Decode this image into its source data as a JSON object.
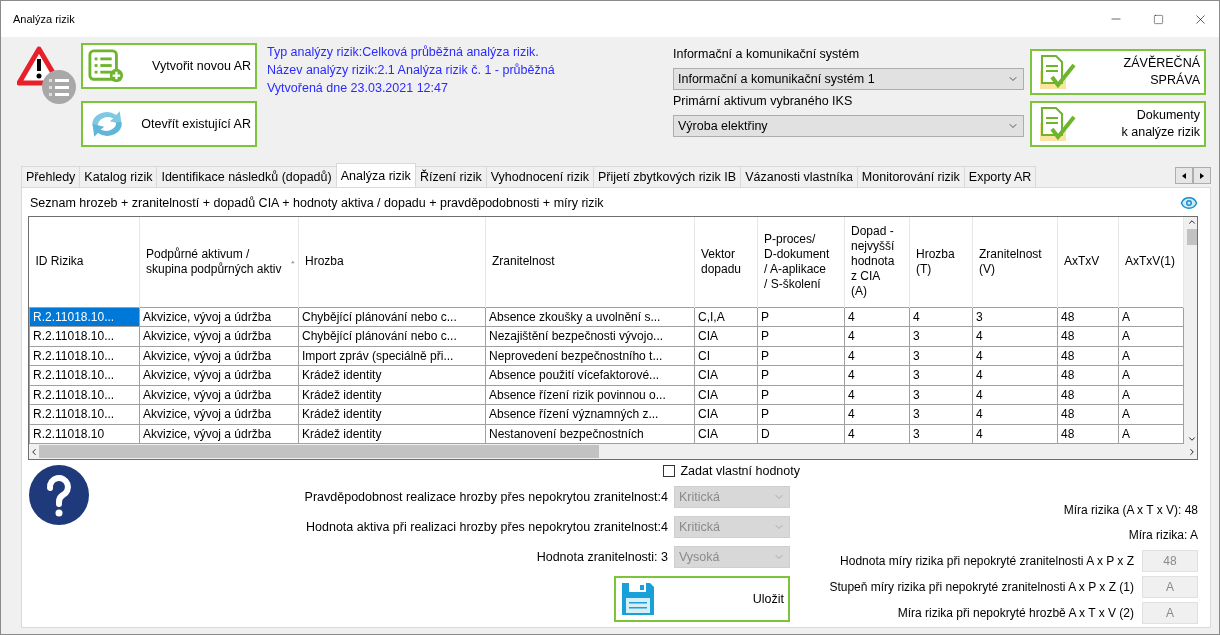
{
  "window": {
    "title": "Analýza rizik"
  },
  "header": {
    "actions": [
      {
        "label": "Vytvořit novou AR"
      },
      {
        "label": "Otevřít existující AR"
      }
    ],
    "info": [
      "Typ analýzy rizik:Celková průběžná analýza rizik.",
      "Název analýzy rizik:2.1 Analýza rizik č. 1 - průběžná",
      "Vytvořená dne 23.03.2021 12:47"
    ],
    "selectors": [
      {
        "label": "Informační a komunikační systém",
        "value": "Informační a komunikační systém 1"
      },
      {
        "label": "Primární aktivum vybraného IKS",
        "value": "Výroba elektřiny"
      }
    ],
    "reports": [
      {
        "lines": [
          "ZÁVĚREČNÁ",
          "SPRÁVA"
        ]
      },
      {
        "lines": [
          "Dokumenty",
          "k analýze rizik"
        ]
      }
    ]
  },
  "tabs": [
    {
      "label": "Přehledy",
      "selected": false
    },
    {
      "label": "Katalog rizik",
      "selected": false
    },
    {
      "label": "Identifikace následků (dopadů)",
      "selected": false
    },
    {
      "label": "Analýza rizik",
      "selected": true
    },
    {
      "label": "Řízení rizik",
      "selected": false
    },
    {
      "label": "Vyhodnocení rizik",
      "selected": false
    },
    {
      "label": "Přijetí zbytkových rizik IB",
      "selected": false
    },
    {
      "label": "Vázanosti vlastníka",
      "selected": false
    },
    {
      "label": "Monitorování rizik",
      "selected": false
    },
    {
      "label": "Exporty AR",
      "selected": false
    }
  ],
  "panel": {
    "caption": "Seznam hrozeb + zranitelností + dopadů CIA + hodnoty aktiva / dopadu + pravděpodobnosti + míry rizik",
    "table": {
      "columns": [
        {
          "label": "ID Rizika",
          "sorted": false
        },
        {
          "label": "Podpůrné aktivum / skupina podpůrných aktiv",
          "sorted": true
        },
        {
          "label": "Hrozba",
          "sorted": false
        },
        {
          "label": "Zranitelnost",
          "sorted": false
        },
        {
          "label": "Vektor\ndopadu",
          "sorted": false
        },
        {
          "label": "P-proces/\nD-dokument\n/ A-aplikace\n/ S-školení",
          "sorted": false
        },
        {
          "label": "Dopad -\nnejvyšší\nhodnota\nz CIA\n(A)",
          "sorted": false
        },
        {
          "label": "Hrozba\n(T)",
          "sorted": false
        },
        {
          "label": "Zranitelnost\n(V)",
          "sorted": false
        },
        {
          "label": "AxTxV",
          "sorted": false
        },
        {
          "label": "AxTxV(1)",
          "sorted": false
        }
      ],
      "rows": [
        {
          "selected": true,
          "cells": [
            "R.2.11018.10...",
            "Akvizice, vývoj a údržba",
            "Chybějící plánování nebo c...",
            "Absence zkoušky a uvolnění s...",
            "C,I,A",
            "P",
            "4",
            "4",
            "3",
            "48",
            "A"
          ]
        },
        {
          "selected": false,
          "cells": [
            "R.2.11018.10...",
            "Akvizice, vývoj a údržba",
            "Chybějící plánování nebo c...",
            "Nezajištění bezpečnosti vývojo...",
            "CIA",
            "P",
            "4",
            "3",
            "4",
            "48",
            "A"
          ]
        },
        {
          "selected": false,
          "cells": [
            "R.2.11018.10...",
            "Akvizice, vývoj a údržba",
            "Import zpráv (speciálně při...",
            "Neprovedení bezpečnostního t...",
            "CI",
            "P",
            "4",
            "3",
            "4",
            "48",
            "A"
          ]
        },
        {
          "selected": false,
          "cells": [
            "R.2.11018.10...",
            "Akvizice, vývoj a údržba",
            "Krádež identity",
            "Absence použití vícefaktorové...",
            "CIA",
            "P",
            "4",
            "3",
            "4",
            "48",
            "A"
          ]
        },
        {
          "selected": false,
          "cells": [
            "R.2.11018.10...",
            "Akvizice, vývoj a údržba",
            "Krádež identity",
            "Absence řízení rizik povinnou o...",
            "CIA",
            "P",
            "4",
            "3",
            "4",
            "48",
            "A"
          ]
        },
        {
          "selected": false,
          "cells": [
            "R.2.11018.10...",
            "Akvizice, vývoj a údržba",
            "Krádež identity",
            "Absence řízení významných z...",
            "CIA",
            "P",
            "4",
            "3",
            "4",
            "48",
            "A"
          ]
        },
        {
          "selected": false,
          "cells": [
            "R.2.11018.10",
            "Akvizice, vývoj a údržba",
            "Krádež identity",
            "Nestanovení bezpečnostních",
            "CIA",
            "D",
            "4",
            "3",
            "4",
            "48",
            "A"
          ]
        }
      ]
    }
  },
  "form": {
    "custom_values": {
      "label": "Zadat vlastní hodnoty",
      "checked": false
    },
    "fields": [
      {
        "label": "Pravděpodobnost realizace hrozby přes nepokrytou zranitelnost:4",
        "value": "Kritická",
        "disabled": true
      },
      {
        "label": "Hodnota aktiva při realizaci hrozby přes nepokrytou zranitelnost:4",
        "value": "Kritická",
        "disabled": true
      },
      {
        "label": "Hodnota zranitelnosti: 3",
        "value": "Vysoká",
        "disabled": true
      }
    ],
    "save": "Uložit"
  },
  "results": {
    "lines": [
      "Míra rizika (A x T x V):  48",
      "Míra rizika: A"
    ],
    "fields": [
      {
        "label": "Hodnota míry rizika při nepokryté zranitelnosti A x P x Z",
        "value": "48",
        "disabled": true
      },
      {
        "label": "Stupeň míry rizika při nepokryté zranitelnosti A x P x Z (1)",
        "value": "A",
        "disabled": true
      },
      {
        "label": "Míra rizika při nepokryté hrozbě A x T x V (2)",
        "value": "A",
        "disabled": true
      }
    ]
  }
}
